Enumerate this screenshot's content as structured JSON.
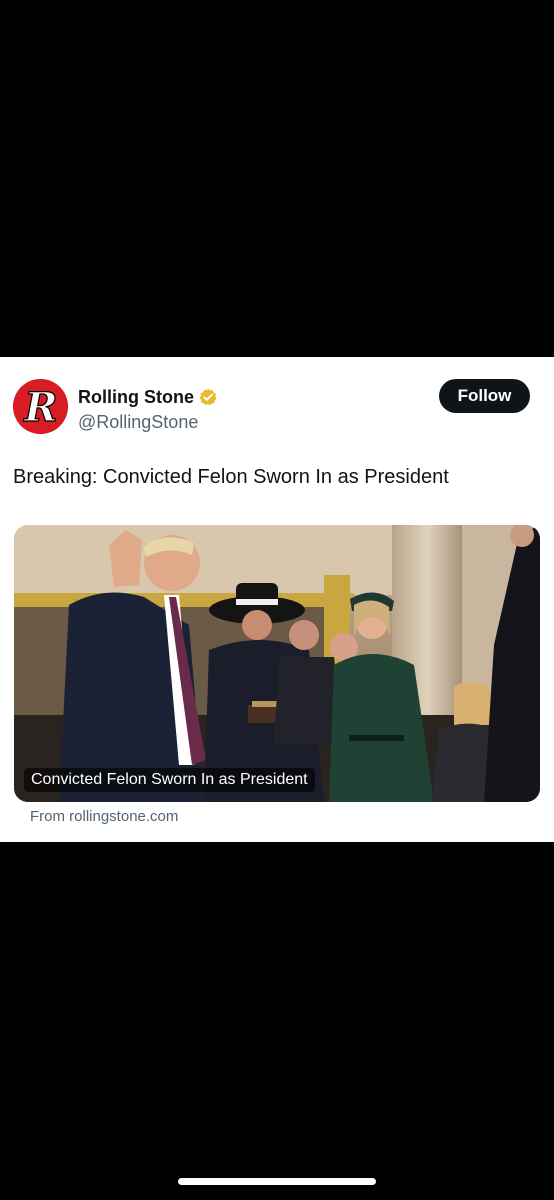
{
  "account": {
    "display_name": "Rolling Stone",
    "handle": "@RollingStone",
    "avatar_letter": "R",
    "avatar_color": "#d71c24",
    "verified_badge": "gold-verified-icon"
  },
  "follow_button": {
    "label": "Follow"
  },
  "tweet": {
    "text": "Breaking: Convicted Felon Sworn In as President"
  },
  "link_card": {
    "caption": "Convicted Felon Sworn In as President",
    "source": "From rollingstone.com"
  },
  "colors": {
    "background": "#000000",
    "card": "#ffffff",
    "text_primary": "#0f1419",
    "text_secondary": "#536471",
    "follow_bg": "#0f1419",
    "badge_gold": "#e8b830"
  }
}
